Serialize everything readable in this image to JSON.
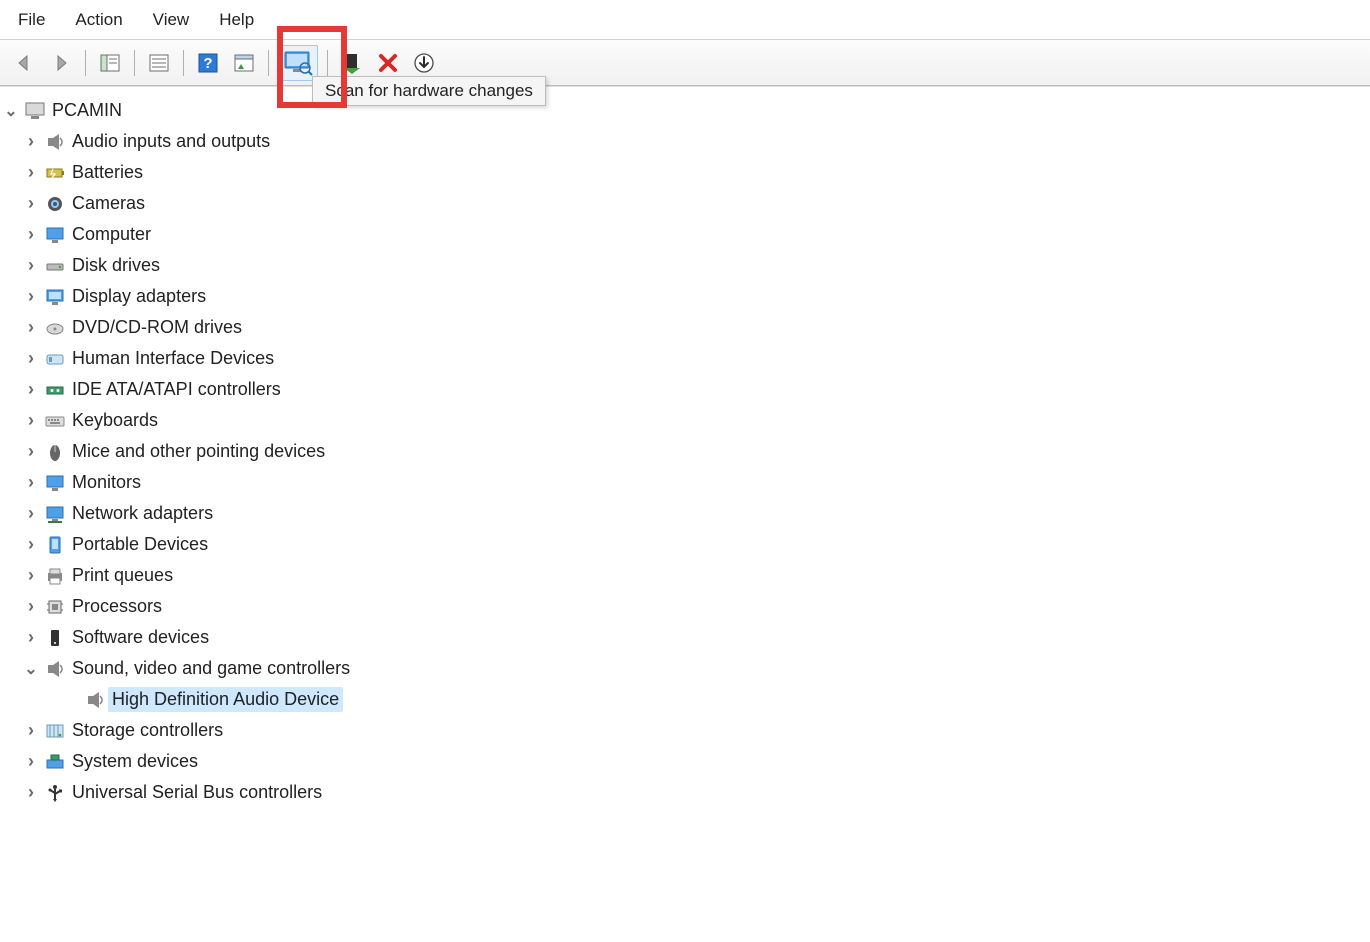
{
  "menu": {
    "file": "File",
    "action": "Action",
    "view": "View",
    "help": "Help"
  },
  "toolbar": {
    "tooltip_scan": "Scan for hardware changes",
    "icons": {
      "back": "back-icon",
      "forward": "forward-icon",
      "show_console_tree": "show-console-tree-icon",
      "properties": "properties-icon",
      "help": "help-icon",
      "show_hidden": "show-hidden-icon",
      "scan_hardware": "scan-hardware-icon",
      "enable": "enable-device-icon",
      "uninstall": "uninstall-device-icon",
      "update_driver": "update-driver-icon"
    }
  },
  "tree": {
    "root": {
      "label": "PCAMIN",
      "expanded": true,
      "icon": "computer-root-icon"
    },
    "categories": [
      {
        "label": "Audio inputs and outputs",
        "icon": "speaker-icon",
        "expanded": false
      },
      {
        "label": "Batteries",
        "icon": "battery-icon",
        "expanded": false
      },
      {
        "label": "Cameras",
        "icon": "camera-icon",
        "expanded": false
      },
      {
        "label": "Computer",
        "icon": "monitor-icon",
        "expanded": false
      },
      {
        "label": "Disk drives",
        "icon": "disk-icon",
        "expanded": false
      },
      {
        "label": "Display adapters",
        "icon": "display-adapter-icon",
        "expanded": false
      },
      {
        "label": "DVD/CD-ROM drives",
        "icon": "optical-drive-icon",
        "expanded": false
      },
      {
        "label": "Human Interface Devices",
        "icon": "hid-icon",
        "expanded": false
      },
      {
        "label": "IDE ATA/ATAPI controllers",
        "icon": "ide-icon",
        "expanded": false
      },
      {
        "label": "Keyboards",
        "icon": "keyboard-icon",
        "expanded": false
      },
      {
        "label": "Mice and other pointing devices",
        "icon": "mouse-icon",
        "expanded": false
      },
      {
        "label": "Monitors",
        "icon": "monitor-icon",
        "expanded": false
      },
      {
        "label": "Network adapters",
        "icon": "network-icon",
        "expanded": false
      },
      {
        "label": "Portable Devices",
        "icon": "portable-icon",
        "expanded": false
      },
      {
        "label": "Print queues",
        "icon": "printer-icon",
        "expanded": false
      },
      {
        "label": "Processors",
        "icon": "cpu-icon",
        "expanded": false
      },
      {
        "label": "Software devices",
        "icon": "software-icon",
        "expanded": false
      },
      {
        "label": "Sound, video and game controllers",
        "icon": "speaker-icon",
        "expanded": true,
        "children": [
          {
            "label": "High Definition Audio Device",
            "icon": "speaker-icon",
            "selected": true
          }
        ]
      },
      {
        "label": "Storage controllers",
        "icon": "storage-icon",
        "expanded": false
      },
      {
        "label": "System devices",
        "icon": "system-icon",
        "expanded": false
      },
      {
        "label": "Universal Serial Bus controllers",
        "icon": "usb-icon",
        "expanded": false
      }
    ]
  },
  "annotation": {
    "highlighted_tool": "scan_hardware"
  }
}
